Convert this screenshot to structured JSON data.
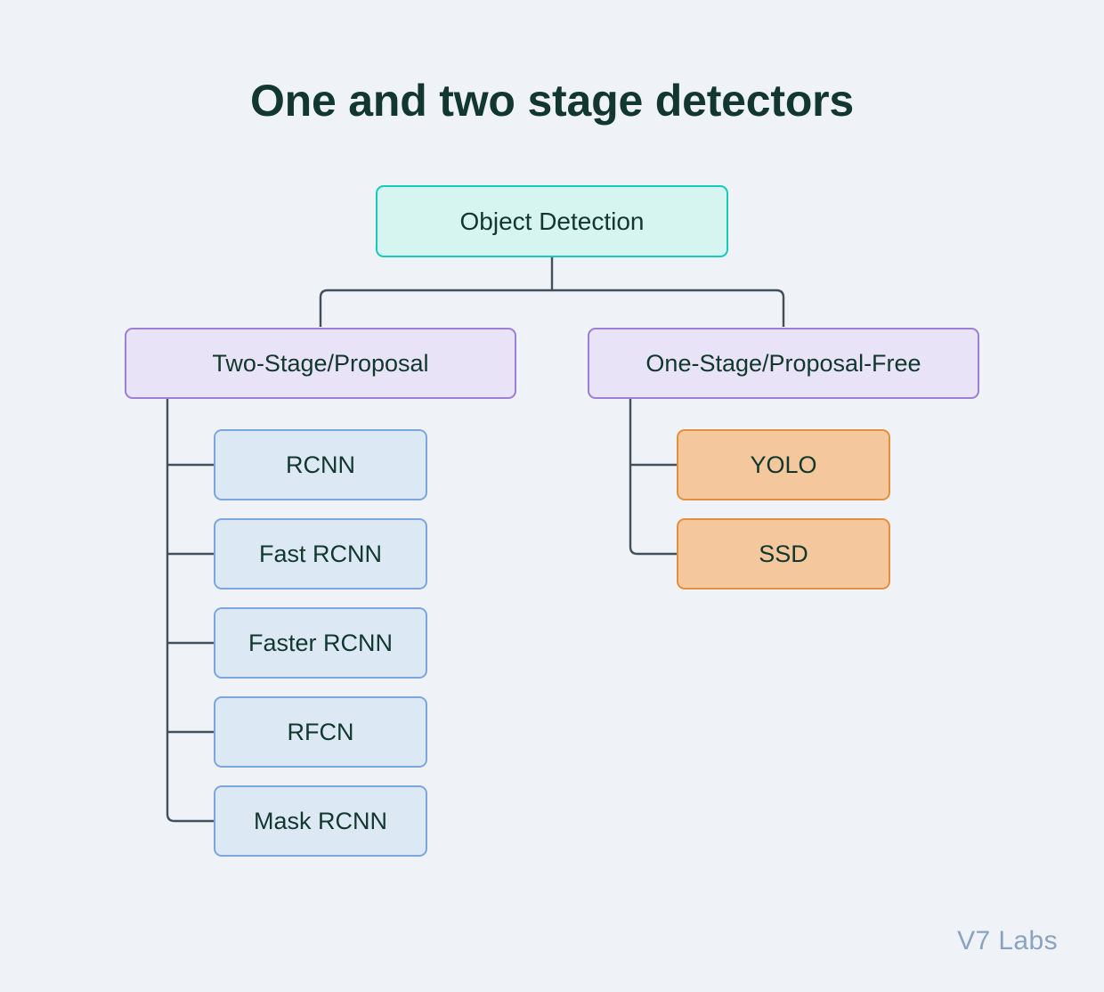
{
  "page": {
    "title": "One and two stage detectors",
    "background_color": "#eff2f7",
    "watermark": "V7 Labs"
  },
  "diagram": {
    "type": "tree",
    "root": {
      "label": "Object Detection",
      "fill": "#d6f5f0",
      "border": "#15cbbd"
    },
    "branches": [
      {
        "label": "Two-Stage/Proposal",
        "fill": "#e8e3f6",
        "border": "#9b7ed6",
        "children": [
          {
            "label": "RCNN",
            "fill": "#dde8f5",
            "border": "#7aa8de"
          },
          {
            "label": "Fast RCNN",
            "fill": "#dde8f5",
            "border": "#7aa8de"
          },
          {
            "label": "Faster RCNN",
            "fill": "#dde8f5",
            "border": "#7aa8de"
          },
          {
            "label": "RFCN",
            "fill": "#dde8f5",
            "border": "#7aa8de"
          },
          {
            "label": "Mask RCNN",
            "fill": "#dde8f5",
            "border": "#7aa8de"
          }
        ]
      },
      {
        "label": "One-Stage/Proposal-Free",
        "fill": "#e8e3f6",
        "border": "#9b7ed6",
        "children": [
          {
            "label": "YOLO",
            "fill": "#f5c79c",
            "border": "#e2903f"
          },
          {
            "label": "SSD",
            "fill": "#f5c79c",
            "border": "#e2903f"
          }
        ]
      }
    ],
    "connector_color": "#41505c",
    "text_color": "#11372e"
  }
}
